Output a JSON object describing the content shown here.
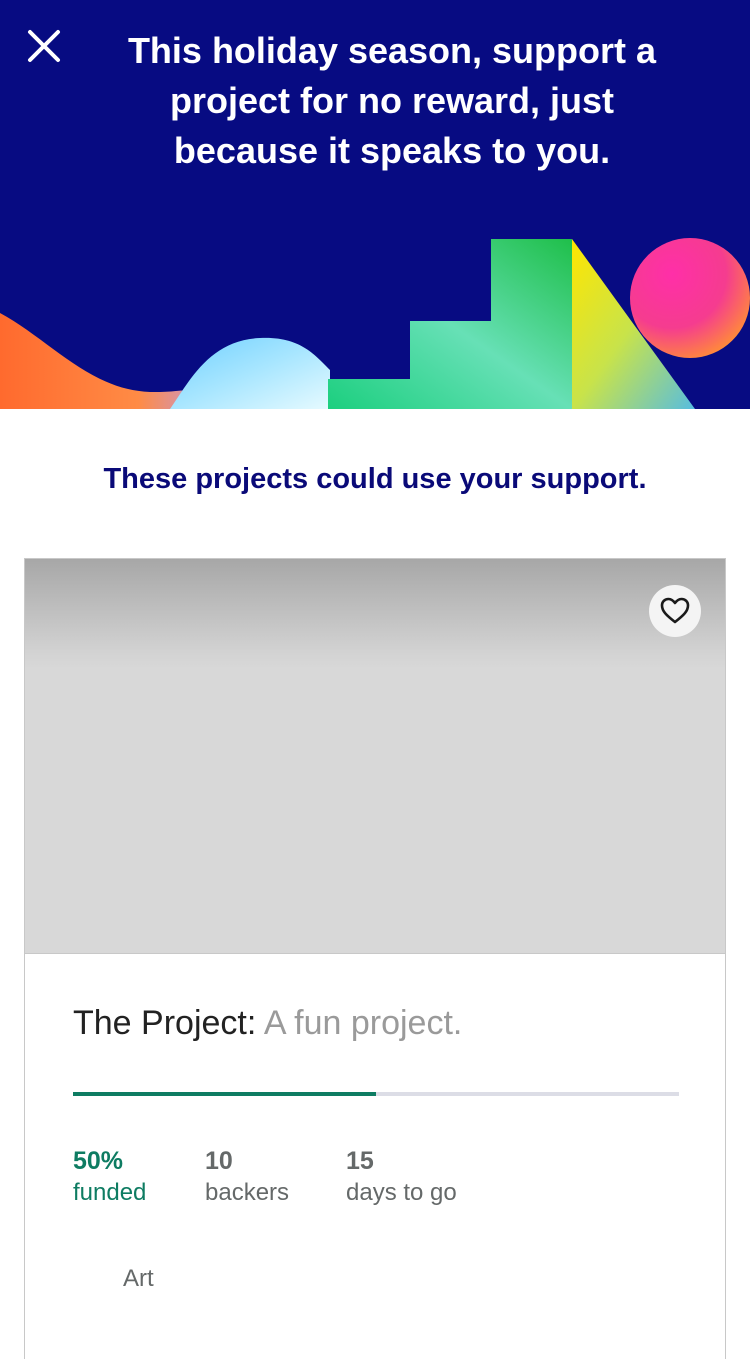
{
  "header": {
    "close_icon": "close-icon",
    "title": "This holiday season, support a project for no reward, just because it speaks to you.",
    "background_color": "#070b82"
  },
  "subtitle": "These projects could use your support.",
  "project_card": {
    "save_icon": "heart-outline-icon",
    "name": "The Project:",
    "blurb": "A fun project.",
    "progress_fraction": 0.5,
    "progress_color": "#0e7c62",
    "stats": [
      {
        "value": "50%",
        "label": "funded"
      },
      {
        "value": "10",
        "label": "backers"
      },
      {
        "value": "15",
        "label": "days to go"
      }
    ],
    "category": "Art"
  }
}
